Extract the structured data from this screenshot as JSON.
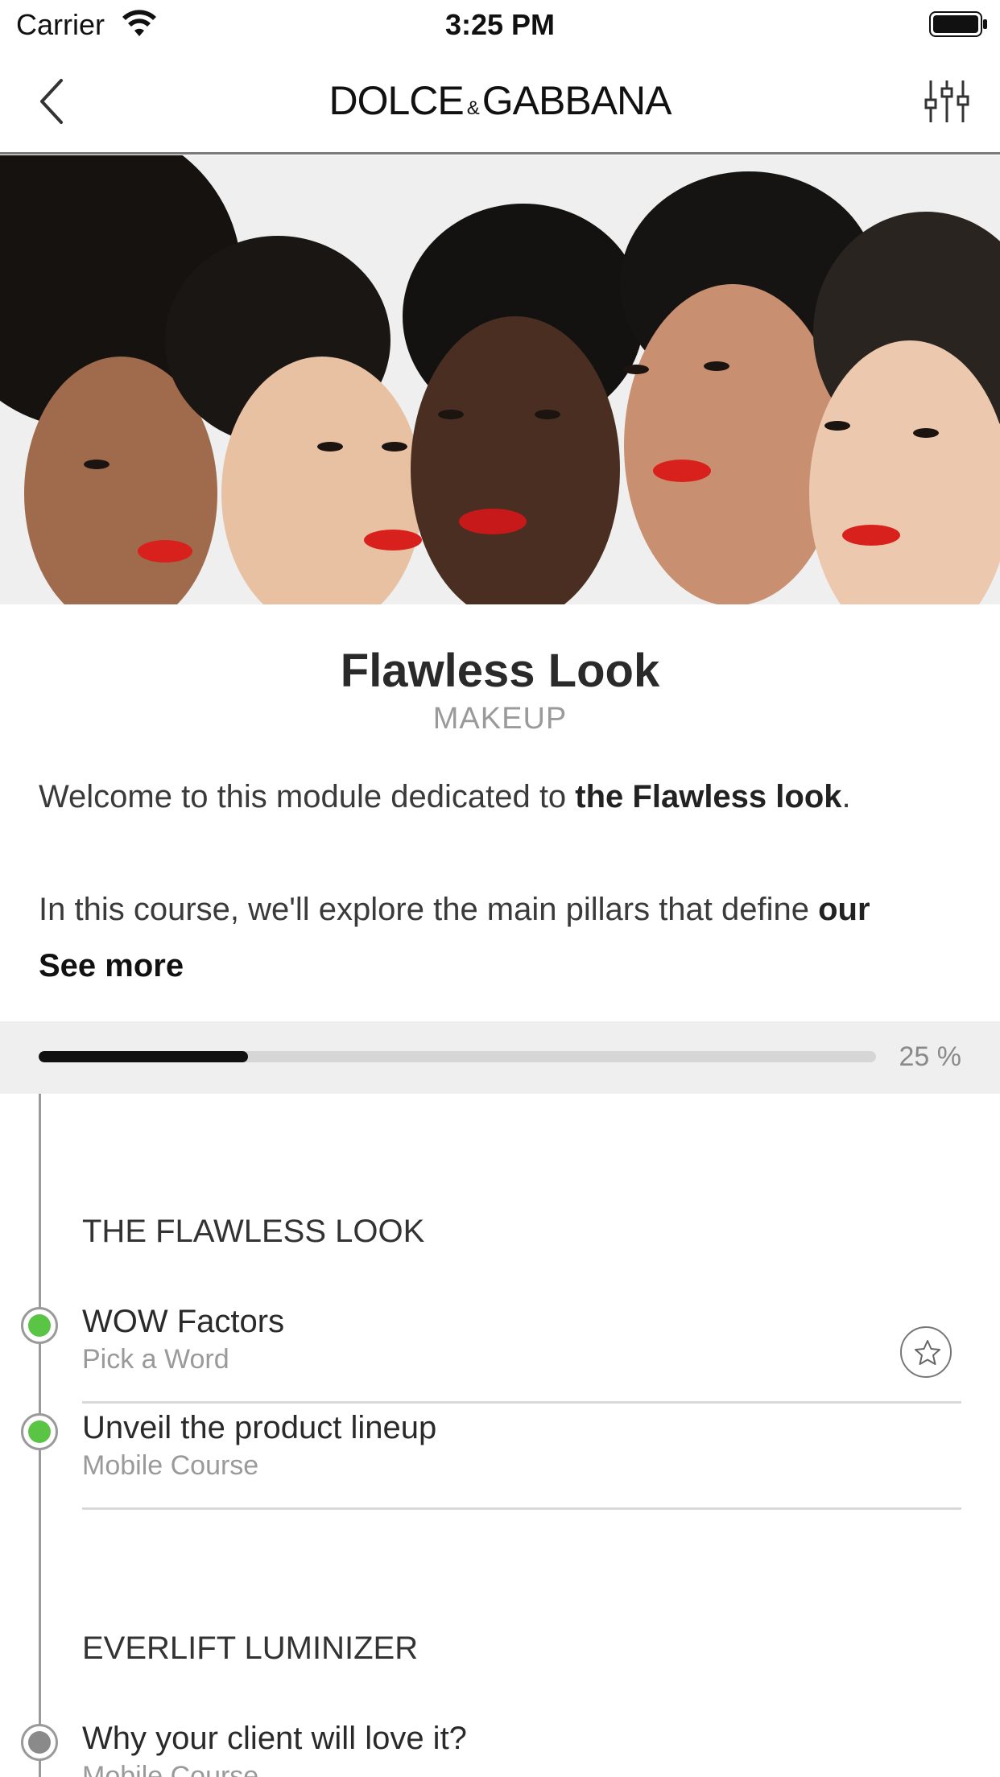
{
  "status_bar": {
    "carrier": "Carrier",
    "time": "3:25 PM"
  },
  "nav": {
    "brand_left": "DOLCE",
    "brand_amp": "&",
    "brand_right": "GABBANA",
    "back_icon": "chevron-left-icon",
    "filter_icon": "sliders-icon"
  },
  "hero": {
    "description": "photo"
  },
  "course": {
    "title": "Flawless Look",
    "category": "MAKEUP",
    "desc1_pre": "Welcome to this module dedicated to ",
    "desc1_bold": "the Flawless look",
    "desc1_post": ".",
    "desc2_pre": "In this course, we'll explore the main pillars that define ",
    "desc2_bold": "our",
    "see_more": "See more"
  },
  "progress": {
    "percent": 25,
    "label": "25 %"
  },
  "sections": [
    {
      "title": "THE FLAWLESS LOOK",
      "lessons": [
        {
          "title": "WOW Factors",
          "subtitle": "Pick a Word",
          "status": "completed",
          "has_star": true
        },
        {
          "title": "Unveil the product lineup",
          "subtitle": "Mobile Course",
          "status": "completed",
          "has_star": false
        }
      ]
    },
    {
      "title": "EVERLIFT LUMINIZER",
      "lessons": [
        {
          "title": "Why your client will love it?",
          "subtitle": "Mobile Course",
          "status": "pending",
          "has_star": false
        }
      ]
    }
  ],
  "colors": {
    "completed_dot": "#5ac445",
    "pending_dot": "#8a8a8a",
    "progress_fill": "#111111"
  }
}
